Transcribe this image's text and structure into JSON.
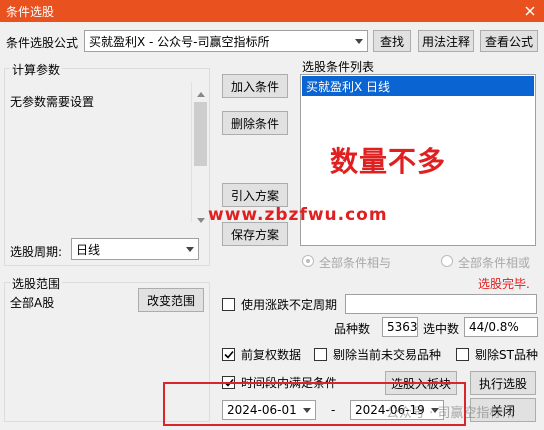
{
  "window": {
    "title": "条件选股"
  },
  "formula": {
    "label": "条件选股公式",
    "selected": "买就盈利X  -  公众号-司赢空指标所",
    "find_button": "查找",
    "usage_button": "用法注释",
    "view_button": "查看公式"
  },
  "params": {
    "group_label": "计算参数",
    "message": "无参数需要设置",
    "period_label": "选股周期:",
    "period_value": "日线"
  },
  "actions": {
    "add": "加入条件",
    "delete": "删除条件",
    "import": "引入方案",
    "save": "保存方案"
  },
  "conditions": {
    "label": "选股条件列表",
    "items": [
      "买就盈利X  日线"
    ],
    "overlay_big": "数量不多",
    "watermark_url": "www.zbzfwu.com",
    "logic_and": "全部条件相与",
    "logic_or": "全部条件相或",
    "status": "选股完毕."
  },
  "range": {
    "group_label": "选股范围",
    "value": "全部A股",
    "change_button": "改变范围"
  },
  "options": {
    "use_period_label": "使用涨跌不定周期",
    "count_label": "品种数",
    "count_value": "5363",
    "selected_label": "选中数",
    "selected_value": "44/0.8%",
    "fq_label": "前复权数据",
    "exclude_untraded_label": "剔除当前未交易品种",
    "exclude_st_label": "剔除ST品种",
    "time_cond_label": "时间段内满足条件",
    "date_sep": "-",
    "date_from": "2024-06-01",
    "date_to": "2024-06-19"
  },
  "footer": {
    "to_block_button": "选股入板块",
    "execute_button": "执行选股",
    "close_button": "关闭",
    "watermark": "公众号 · 司赢空指标所"
  },
  "colors": {
    "titlebar": "#e9511f",
    "selection": "#0a64d2",
    "overlay_red": "#e02020",
    "annotation_box": "#d9262c"
  }
}
